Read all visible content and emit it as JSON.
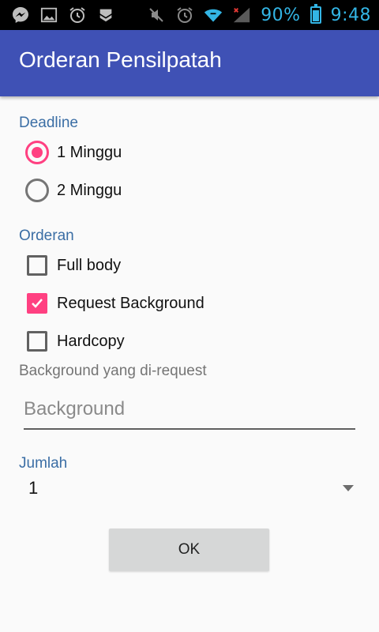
{
  "status_bar": {
    "icons": [
      "messenger-icon",
      "image-icon",
      "alarm-icon",
      "download-icon",
      "mute-icon",
      "alarm-icon",
      "wifi-icon",
      "signal-icon",
      "battery-icon"
    ],
    "battery_percent": "90%",
    "time": "9:48",
    "accent_color": "#33b5e5"
  },
  "app_bar": {
    "title": "Orderan Pensilpatah",
    "color": "#3f51b5"
  },
  "deadline": {
    "label": "Deadline",
    "options": [
      {
        "label": "1 Minggu",
        "selected": true
      },
      {
        "label": "2 Minggu",
        "selected": false
      }
    ]
  },
  "orderan": {
    "label": "Orderan",
    "options": [
      {
        "label": "Full body",
        "checked": false
      },
      {
        "label": "Request Background",
        "checked": true
      },
      {
        "label": "Hardcopy",
        "checked": false
      }
    ]
  },
  "background_field": {
    "label": "Background yang di-request",
    "placeholder": "Background",
    "value": ""
  },
  "jumlah": {
    "label": "Jumlah",
    "selected": "1"
  },
  "ok_button": {
    "label": "OK"
  },
  "accent_color": "#ff4081"
}
